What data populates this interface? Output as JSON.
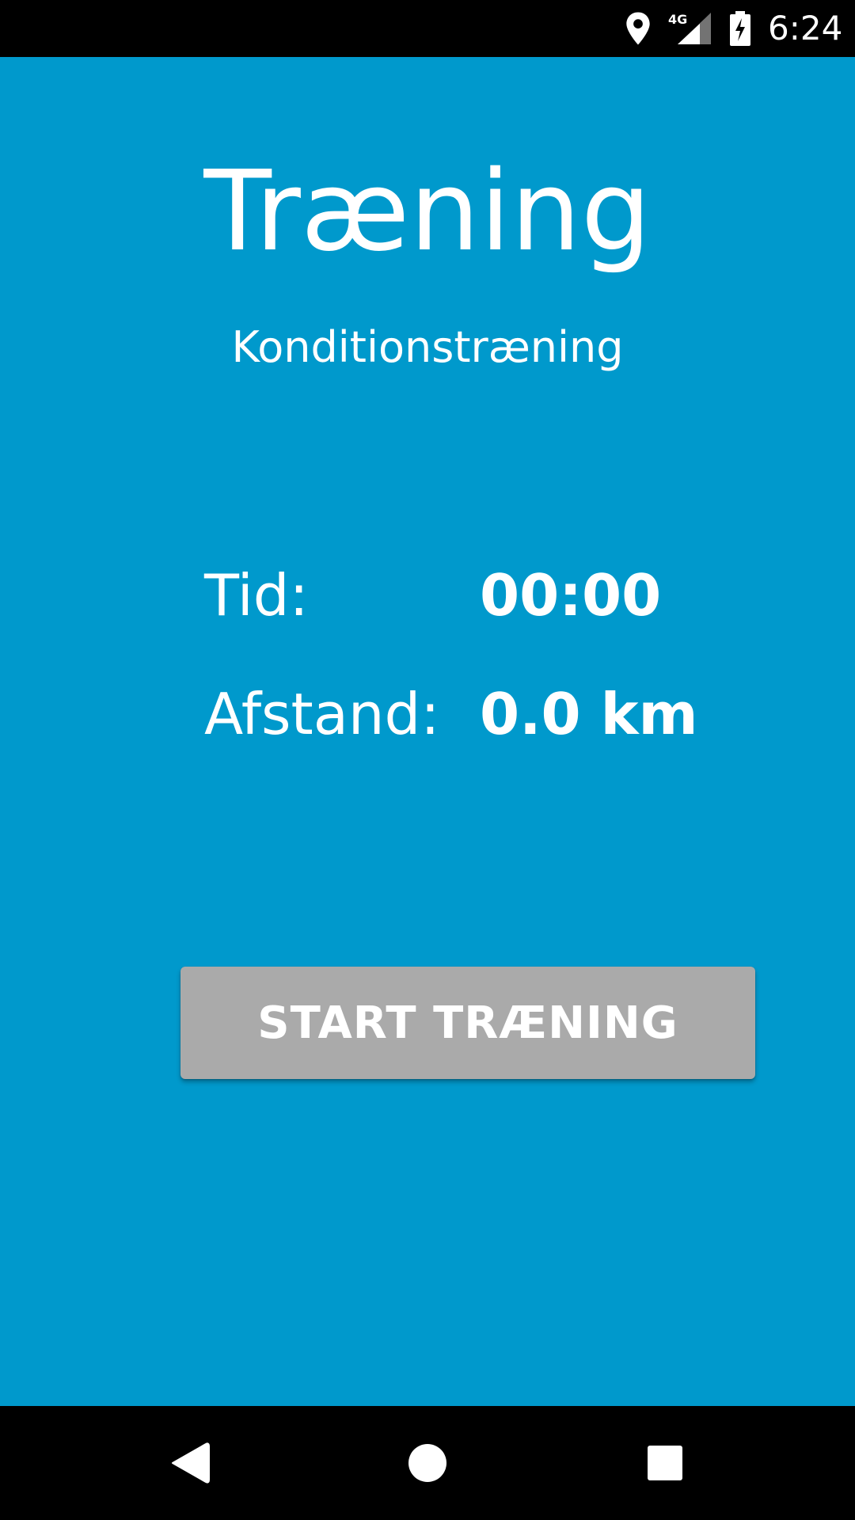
{
  "status_bar": {
    "time": "6:24",
    "network": "4G",
    "icons": [
      "location-icon",
      "signal-icon",
      "battery-charging-icon"
    ]
  },
  "main": {
    "title": "Træning",
    "subtitle": "Konditionstræning",
    "stats": {
      "time_label": "Tid:",
      "time_value": "00:00",
      "distance_label": "Afstand:",
      "distance_value": "0.0 km"
    },
    "start_button_label": "START TRÆNING"
  },
  "nav_bar": {
    "icons": [
      "back-icon",
      "home-icon",
      "recents-icon"
    ]
  },
  "colors": {
    "background": "#0099CC",
    "button": "#AAAAAA",
    "bars": "#000000",
    "text": "#FFFFFF"
  }
}
